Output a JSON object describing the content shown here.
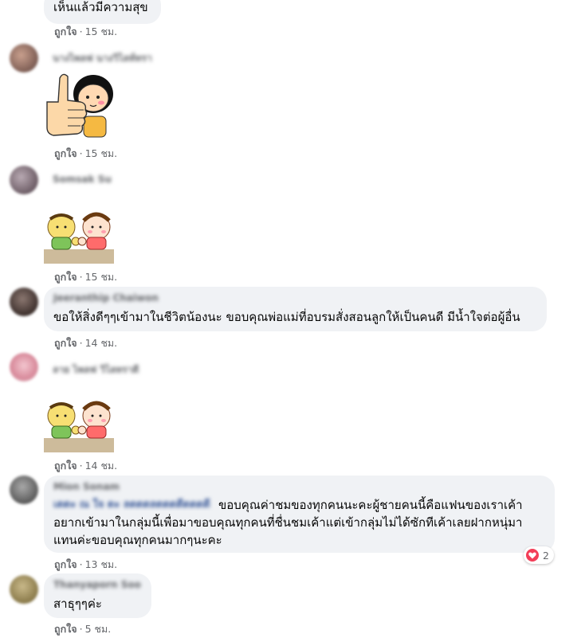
{
  "comments": [
    {
      "text": "เห็นแล้วมีความสุข",
      "like": "ถูกใจ",
      "time": "15 ชม."
    },
    {
      "author": "นางไพลฟ นางวิไลท์ทรา",
      "like": "ถูกใจ",
      "time": "15 ชม."
    },
    {
      "author": "Somsak Su",
      "like": "ถูกใจ",
      "time": "15 ชม."
    },
    {
      "author": "Jeeranthip Chaiwon",
      "text": "ขอให้สิ่งดีๆๆเข้ามาในชีวิตน้องนะ ขอบคุณพ่อแม่ที่อบรมสั่งสอนลูกให้เป็นคนดี มีน้ำใจต่อผู้อื่น",
      "like": "ถูกใจ",
      "time": "14 ชม."
    },
    {
      "author": "ลาย ไพลฟ วิไลทราดี",
      "like": "ถูกใจ",
      "time": "14 ชม."
    },
    {
      "author": "Mion Sonam",
      "mention": "เดดะ ณ ใจ ดะ ลดดดลดดดดีดดดดี",
      "lines": [
        "ขอบคุณค่าชมของทุกคนนะคะผู้ชายคนนี้คือแฟนของเราเค้า",
        "อยากเข้ามาในกลุ่มนี้เพื่อมาขอบคุณทุกคนที่ชื่นชมเค้าแต่เข้ากลุ่มไม่ได้ซักทีเค้าเลยฝากหนุ่มา",
        "แทนค่ะขอบคุณทุกคนมากๆนะคะ"
      ],
      "like": "ถูกใจ",
      "time": "13 ชม.",
      "reaction_count": "2"
    },
    {
      "author": "Thanyaporn Soo",
      "text": "สาธุๆๆค่ะ",
      "like": "ถูกใจ",
      "time": "5 ชม."
    }
  ],
  "dot": "·",
  "colors": {
    "bubble": "#f0f2f5",
    "meta": "#65676b",
    "heart": "#f33e58"
  }
}
